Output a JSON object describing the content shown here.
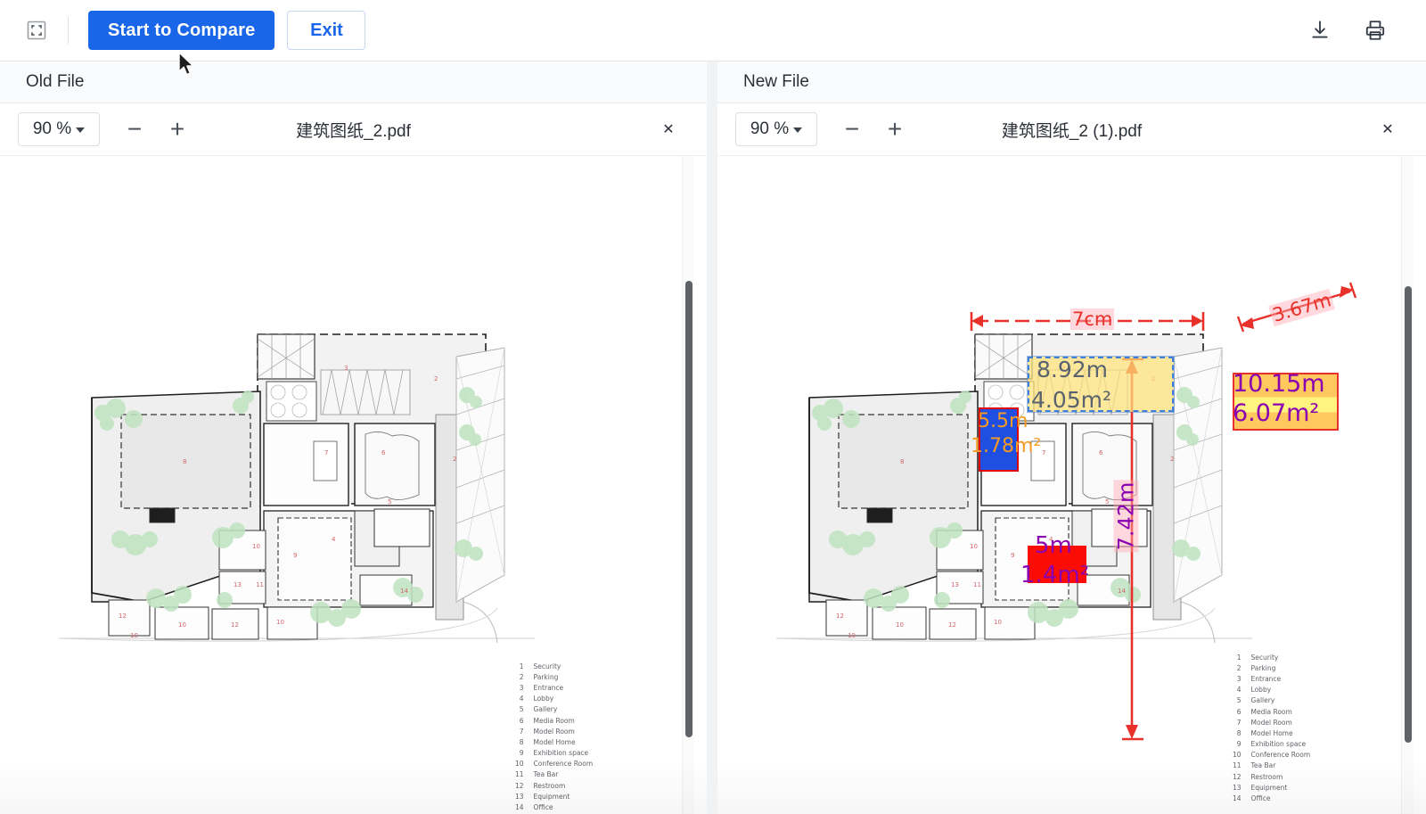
{
  "toolbar": {
    "fullscreen_icon": "fullscreen-icon",
    "start_compare_label": "Start to Compare",
    "exit_label": "Exit",
    "download_icon": "download-icon",
    "print_icon": "print-icon"
  },
  "panes": {
    "left": {
      "label": "Old File",
      "zoom_value": "90 %",
      "minus_label": "−",
      "plus_label": "+",
      "filename": "建筑图纸_2.pdf",
      "close_label": "✕"
    },
    "right": {
      "label": "New File",
      "zoom_value": "90 %",
      "minus_label": "−",
      "plus_label": "+",
      "filename": "建筑图纸_2 (1).pdf",
      "close_label": "✕"
    }
  },
  "legend": {
    "items": [
      {
        "num": "1",
        "name": "Security"
      },
      {
        "num": "2",
        "name": "Parking"
      },
      {
        "num": "3",
        "name": "Entrance"
      },
      {
        "num": "4",
        "name": "Lobby"
      },
      {
        "num": "5",
        "name": "Gallery"
      },
      {
        "num": "6",
        "name": "Media Room"
      },
      {
        "num": "7",
        "name": "Model Room"
      },
      {
        "num": "8",
        "name": "Model Home"
      },
      {
        "num": "9",
        "name": "Exhibition space"
      },
      {
        "num": "10",
        "name": "Conference Room"
      },
      {
        "num": "11",
        "name": "Tea Bar"
      },
      {
        "num": "12",
        "name": "Restroom"
      },
      {
        "num": "13",
        "name": "Equipment"
      },
      {
        "num": "14",
        "name": "Office"
      }
    ]
  },
  "annotations": {
    "width_dim": "7cm",
    "height_dim": "7.42m",
    "diagonal_dim": "3.67m",
    "yellow_box": {
      "length": "8.92m",
      "area": "4.05m²"
    },
    "blue_box": {
      "length": "5.5m",
      "area": "1.78m²"
    },
    "red_box": {
      "length": "5m",
      "area": "1.4m²"
    },
    "legend_box": {
      "length": "10.15m",
      "area": "6.07m²"
    }
  },
  "colors": {
    "accent": "#1966e8",
    "measure_red": "#e8312a",
    "measure_purple": "#8b00b0",
    "box_blue": "#1f4fe0",
    "box_red": "#fb0d06",
    "box_yellow": "#ffe278"
  },
  "scroll": {
    "left_thumb_label": "left-scroll-thumb",
    "right_thumb_label": "right-scroll-thumb"
  }
}
